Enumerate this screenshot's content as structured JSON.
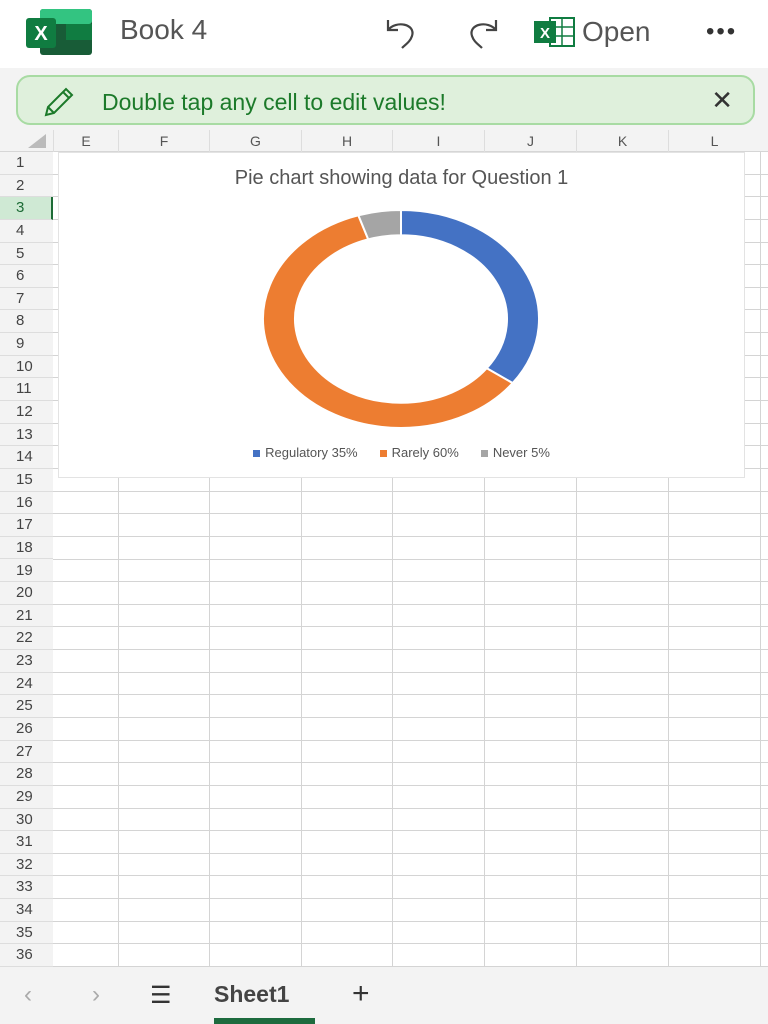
{
  "header": {
    "title": "Book 4",
    "open_label": "Open",
    "more_label": "•••"
  },
  "banner": {
    "message": "Double tap any cell to edit values!",
    "close_label": "✕"
  },
  "columns": [
    "E",
    "F",
    "G",
    "H",
    "I",
    "J",
    "K",
    "L"
  ],
  "rows": [
    "1",
    "2",
    "3",
    "4",
    "5",
    "6",
    "7",
    "8",
    "9",
    "10",
    "11",
    "12",
    "13",
    "14",
    "15",
    "16",
    "17",
    "18",
    "19",
    "20",
    "21",
    "22",
    "23",
    "24",
    "25",
    "26",
    "27",
    "28",
    "29",
    "30",
    "31",
    "32",
    "33",
    "34",
    "35",
    "36"
  ],
  "selected_row": "3",
  "chart_data": {
    "type": "pie",
    "title": "Pie chart showing data for Question 1",
    "categories": [
      "Regulatory",
      "Rarely",
      "Never"
    ],
    "values": [
      35,
      60,
      5
    ],
    "legend_labels": [
      "Regulatory 35%",
      "Rarely 60%",
      "Never 5%"
    ],
    "colors": [
      "#4472c4",
      "#ed7d31",
      "#a5a5a5"
    ],
    "legend": "bottom",
    "donut": true
  },
  "footer": {
    "prev": "‹",
    "next": "›",
    "menu": "☰",
    "sheet": "Sheet1",
    "add": "+"
  }
}
